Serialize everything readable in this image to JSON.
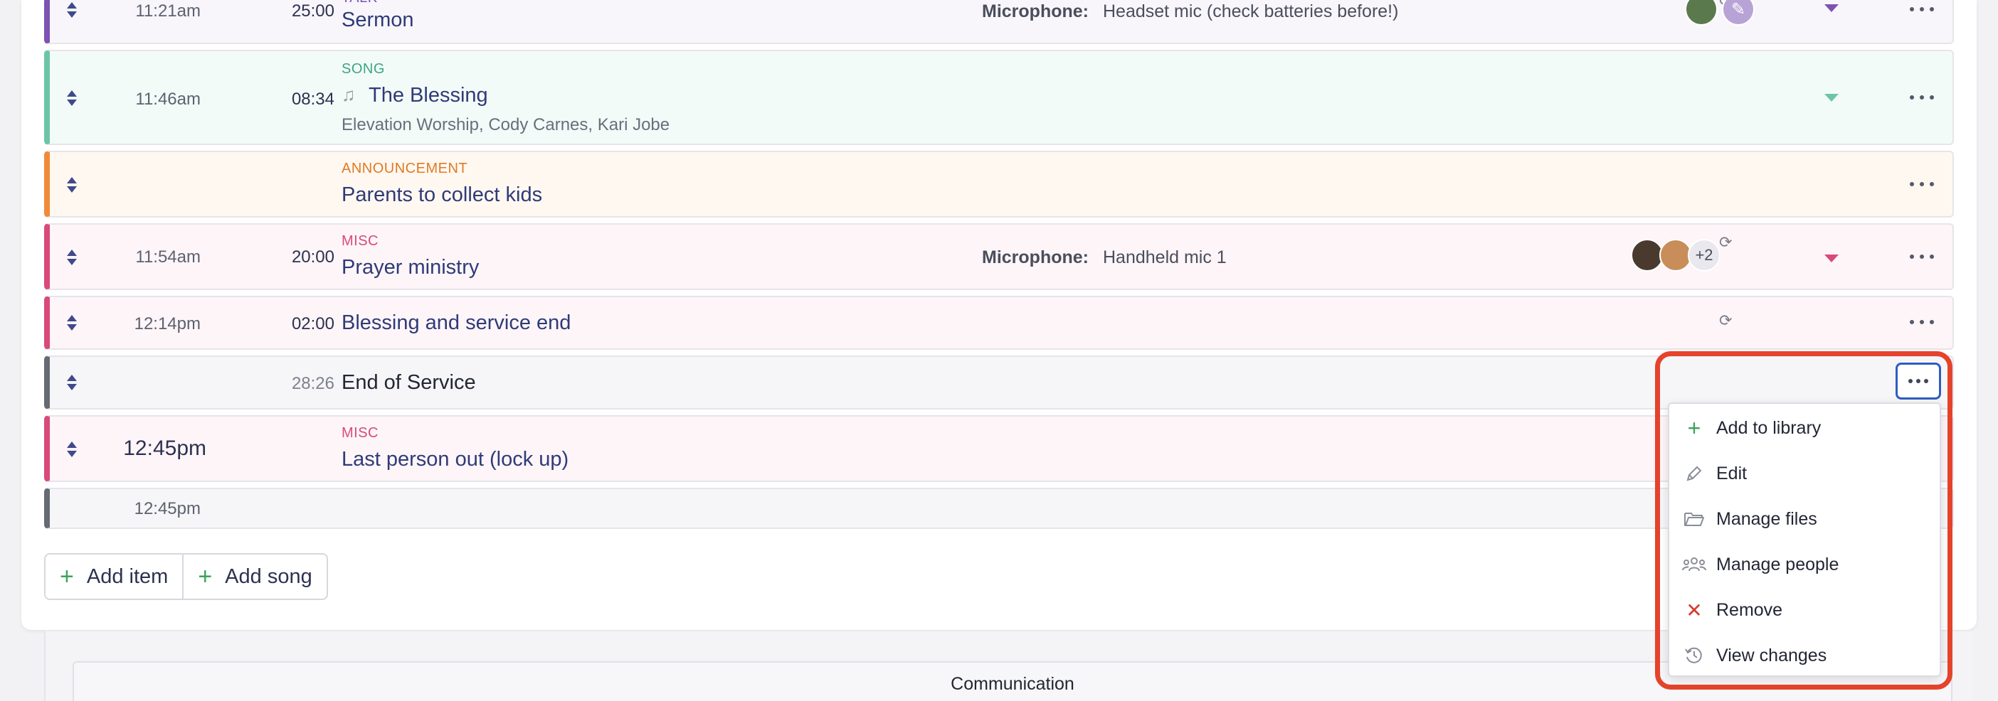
{
  "rows": [
    {
      "category": "TALK",
      "time": "11:21am",
      "duration": "25:00",
      "title": "Sermon",
      "mic_label": "Microphone:",
      "mic_value": "Headset mic (check batteries before!)",
      "accent": "#7c52b3"
    },
    {
      "category": "SONG",
      "time": "11:46am",
      "duration": "08:34",
      "title": "The Blessing",
      "artists": "Elevation Worship, Cody Carnes, Kari Jobe",
      "accent": "#6cc6a6"
    },
    {
      "category": "ANNOUNCEMENT",
      "title": "Parents to collect kids",
      "accent": "#ef8a3a"
    },
    {
      "category": "MISC",
      "time": "11:54am",
      "duration": "20:00",
      "title": "Prayer ministry",
      "mic_label": "Microphone:",
      "mic_value": "Handheld mic 1",
      "extra_people": "+2",
      "accent": "#d9497c"
    },
    {
      "time": "12:14pm",
      "duration": "02:00",
      "title": "Blessing and service end",
      "accent": "#d9497c"
    },
    {
      "duration": "28:26",
      "title": "End of Service",
      "accent": "#666a73"
    },
    {
      "category": "MISC",
      "time": "12:45pm",
      "title": "Last person out (lock up)",
      "accent": "#d9497c"
    },
    {
      "time": "12:45pm",
      "accent": "#666a73"
    }
  ],
  "buttons": {
    "add_item": "Add item",
    "add_song": "Add song"
  },
  "menu": {
    "items": [
      {
        "label": "Add to library",
        "icon": "plus-icon"
      },
      {
        "label": "Edit",
        "icon": "pencil-icon"
      },
      {
        "label": "Manage files",
        "icon": "folder-icon"
      },
      {
        "label": "Manage people",
        "icon": "people-icon"
      },
      {
        "label": "Remove",
        "icon": "x-icon"
      },
      {
        "label": "View changes",
        "icon": "history-icon"
      }
    ]
  },
  "section": {
    "communication": "Communication"
  },
  "colors": {
    "highlight": "#e5432c",
    "focus": "#2f5cc2",
    "add_green": "#3aa35a",
    "remove_red": "#d93a2e"
  }
}
